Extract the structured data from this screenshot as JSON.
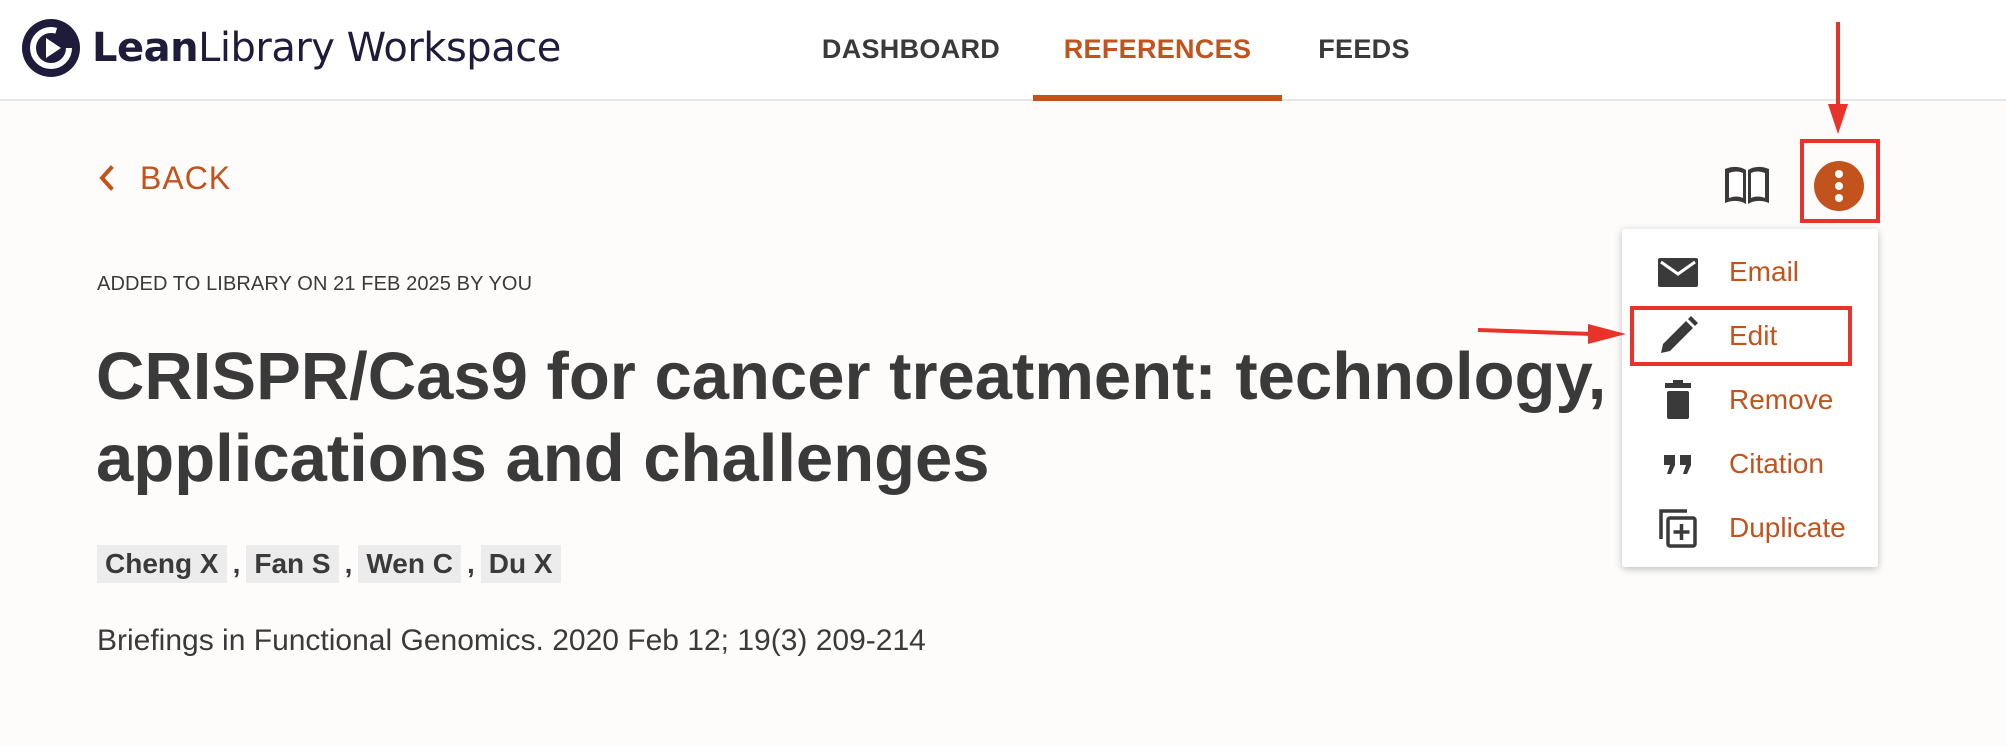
{
  "app": {
    "logo_bold": "Lean",
    "logo_rest": "Library Workspace",
    "brand_color": "#c2531d",
    "logo_color": "#1f1c3b"
  },
  "nav": {
    "tabs": [
      {
        "label": "DASHBOARD",
        "active": false
      },
      {
        "label": "REFERENCES",
        "active": true
      },
      {
        "label": "FEEDS",
        "active": false
      }
    ]
  },
  "toolbar": {
    "back_label": "BACK",
    "read_icon": "book-open-icon",
    "more_icon": "more-vertical-icon"
  },
  "reference": {
    "added": "ADDED TO LIBRARY ON 21 FEB 2025 BY YOU",
    "title_line1": "CRISPR/Cas9 for cancer treatment: technology, c",
    "title_line2": "applications and challenges",
    "authors": [
      "Cheng X",
      "Fan S",
      "Wen C",
      "Du X"
    ],
    "author_separator": ",",
    "journal": "Briefings in Functional Genomics. 2020 Feb 12; 19(3) 209-214"
  },
  "menu": {
    "items": [
      {
        "label": "Email",
        "icon": "email-icon"
      },
      {
        "label": "Edit",
        "icon": "pencil-icon"
      },
      {
        "label": "Remove",
        "icon": "trash-icon"
      },
      {
        "label": "Citation",
        "icon": "quote-icon"
      },
      {
        "label": "Duplicate",
        "icon": "duplicate-icon"
      }
    ]
  },
  "annotations": {
    "highlight_color": "#e8322a"
  }
}
